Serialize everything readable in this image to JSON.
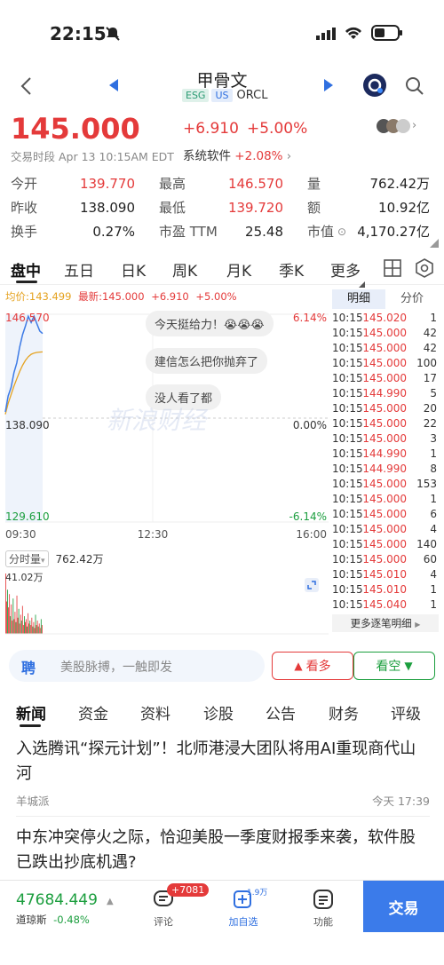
{
  "status_bar": {
    "time": "22:15"
  },
  "header": {
    "title": "甲骨文",
    "badges": [
      "ESG",
      "US"
    ],
    "ticker": "ORCL"
  },
  "quote": {
    "price": "145.000",
    "change": "+6.910",
    "change_pct": "+5.00%",
    "session": "交易时段 Apr 13 10:15AM EDT",
    "sector_name": "系统软件",
    "sector_change": "+2.08%"
  },
  "stats": [
    {
      "label": "今开",
      "value": "139.770",
      "color": "red"
    },
    {
      "label": "最高",
      "value": "146.570",
      "color": "red"
    },
    {
      "label": "量",
      "value": "762.42万",
      "color": "normal"
    },
    {
      "label": "昨收",
      "value": "138.090",
      "color": "normal"
    },
    {
      "label": "最低",
      "value": "139.720",
      "color": "red"
    },
    {
      "label": "额",
      "value": "10.92亿",
      "color": "normal"
    },
    {
      "label": "换手",
      "value": "0.27%",
      "color": "normal"
    },
    {
      "label": "市盈 TTM",
      "value": "25.48",
      "color": "normal"
    },
    {
      "label": "市值",
      "value": "4,170.27亿",
      "color": "normal"
    }
  ],
  "chart_tabs": [
    "盘中",
    "五日",
    "日K",
    "周K",
    "月K",
    "季K",
    "更多"
  ],
  "chart_header": {
    "avg": "均价:143.499",
    "latest": "最新:145.000",
    "chg": "+6.910",
    "pct": "+5.00%"
  },
  "chart_data": {
    "type": "line",
    "ylim": [
      129.61,
      146.57
    ],
    "y_left_ticks": [
      "146.570",
      "138.090",
      "129.610"
    ],
    "y_right_ticks": [
      "6.14%",
      "0.00%",
      "-6.14%"
    ],
    "x_ticks": [
      "09:30",
      "12:30",
      "16:00"
    ],
    "series": [
      {
        "values": [
          138.6,
          139.9,
          140.6,
          141.8,
          142.6,
          143.9,
          144.9,
          145.6,
          146.4,
          145.9,
          146.4,
          145.8,
          145.2,
          145.0
        ]
      },
      {
        "values": [
          138.4,
          139.3,
          140.0,
          140.7,
          141.3,
          141.9,
          142.4,
          142.8,
          143.1,
          143.3,
          143.4,
          143.45,
          143.48,
          143.499
        ]
      }
    ],
    "volume_label": "分时量",
    "volume_total": "762.42万",
    "volume_max": "41.02万",
    "volume_values": [
      41.0,
      22.0,
      30.0,
      18.0,
      27.0,
      12.0,
      20.0,
      9.0,
      24.0,
      10.0,
      15.0,
      8.0,
      26.0,
      11.0,
      17.0,
      7.0,
      13.0,
      9.0,
      19.0,
      6.0,
      12.0,
      8.0,
      10.0,
      5.0,
      14.0,
      7.0,
      9.0,
      6.0,
      11.0,
      5.0,
      8.0,
      4.0,
      13.0,
      6.0,
      9.0,
      5.0,
      7.0,
      4.0,
      10.0,
      6.0
    ]
  },
  "comments": [
    "今天挺给力！😭😭😭",
    "建信怎么把你抛弃了",
    "没人看了都"
  ],
  "watermark": "新浪财经",
  "ticks_panel": {
    "tabs": [
      "明细",
      "分价"
    ],
    "rows": [
      {
        "time": "10:15",
        "price": "145.020",
        "vol": "1"
      },
      {
        "time": "10:15",
        "price": "145.000",
        "vol": "42"
      },
      {
        "time": "10:15",
        "price": "145.000",
        "vol": "42"
      },
      {
        "time": "10:15",
        "price": "145.000",
        "vol": "100"
      },
      {
        "time": "10:15",
        "price": "145.000",
        "vol": "17"
      },
      {
        "time": "10:15",
        "price": "144.990",
        "vol": "5"
      },
      {
        "time": "10:15",
        "price": "145.000",
        "vol": "20"
      },
      {
        "time": "10:15",
        "price": "145.000",
        "vol": "22"
      },
      {
        "time": "10:15",
        "price": "145.000",
        "vol": "3"
      },
      {
        "time": "10:15",
        "price": "144.990",
        "vol": "1"
      },
      {
        "time": "10:15",
        "price": "144.990",
        "vol": "8"
      },
      {
        "time": "10:15",
        "price": "145.000",
        "vol": "153"
      },
      {
        "time": "10:15",
        "price": "145.000",
        "vol": "1"
      },
      {
        "time": "10:15",
        "price": "145.000",
        "vol": "6"
      },
      {
        "time": "10:15",
        "price": "145.000",
        "vol": "4"
      },
      {
        "time": "10:15",
        "price": "145.000",
        "vol": "140"
      },
      {
        "time": "10:15",
        "price": "145.000",
        "vol": "60"
      },
      {
        "time": "10:15",
        "price": "145.010",
        "vol": "4"
      },
      {
        "time": "10:15",
        "price": "145.010",
        "vol": "1"
      },
      {
        "time": "10:15",
        "price": "145.040",
        "vol": "1"
      }
    ],
    "more": "更多逐笔明细"
  },
  "promo": {
    "badge": "聘",
    "text": "美股脉搏，一触即发",
    "bull": "看多",
    "bear": "看空"
  },
  "news_tabs": [
    "新闻",
    "资金",
    "资料",
    "诊股",
    "公告",
    "财务",
    "评级"
  ],
  "news": [
    {
      "title": "入选腾讯“探元计划”！北师港浸大团队将用AI重现商代山河",
      "source": "羊城派",
      "time": "今天 17:39"
    },
    {
      "title": "中东冲突停火之际，恰迎美股一季度财报季来袭，软件股已跌出抄底机遇?",
      "source": "",
      "time": ""
    }
  ],
  "bottom": {
    "index_value": "47684.449",
    "index_name": "道琼斯",
    "index_pct": "-0.48%",
    "comment_label": "评论",
    "comment_badge": "+7081",
    "add_label": "加自选",
    "add_count": "1.9万",
    "func_label": "功能",
    "trade_label": "交易"
  },
  "colors": {
    "red": "#e43a3a",
    "green": "#1b9e3e",
    "blue": "#2f6fe0"
  }
}
